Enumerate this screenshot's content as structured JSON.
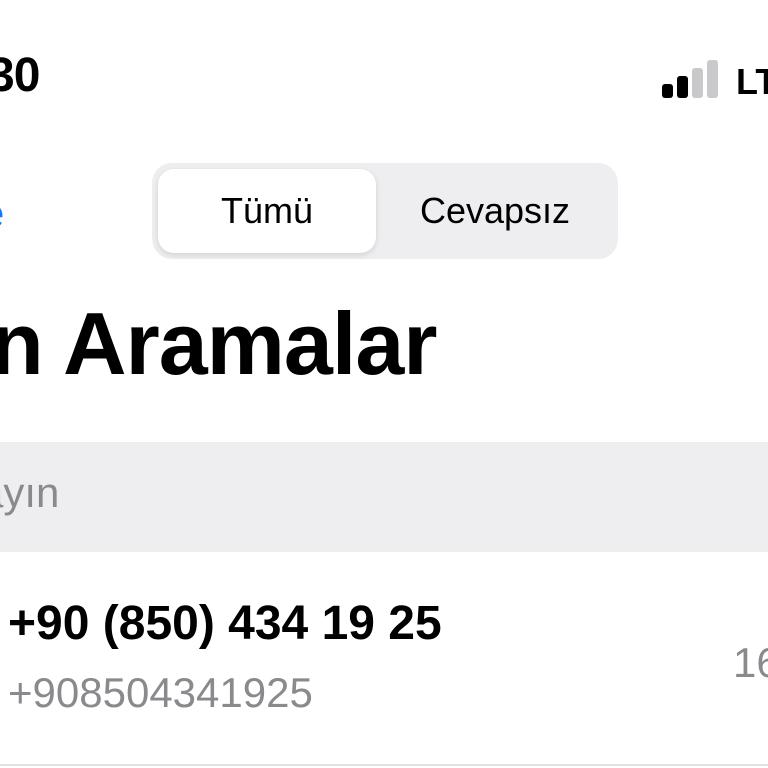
{
  "status_bar": {
    "time": "30",
    "network": "LT",
    "signal_bars_active": 2,
    "signal_bars_total": 4
  },
  "nav": {
    "edit_label": "e",
    "segments": [
      "Tümü",
      "Cevapsız"
    ],
    "selected_segment": "Tümü"
  },
  "title": "n Aramalar",
  "search": {
    "placeholder": "ayın"
  },
  "calls": [
    {
      "number": "+90 (850) 434 19 25",
      "subtitle": "+908504341925",
      "time": "16"
    }
  ],
  "colors": {
    "accent": "#0a7aff",
    "secondary_text": "#8a8a8e",
    "search_bg": "#eeeef0"
  }
}
